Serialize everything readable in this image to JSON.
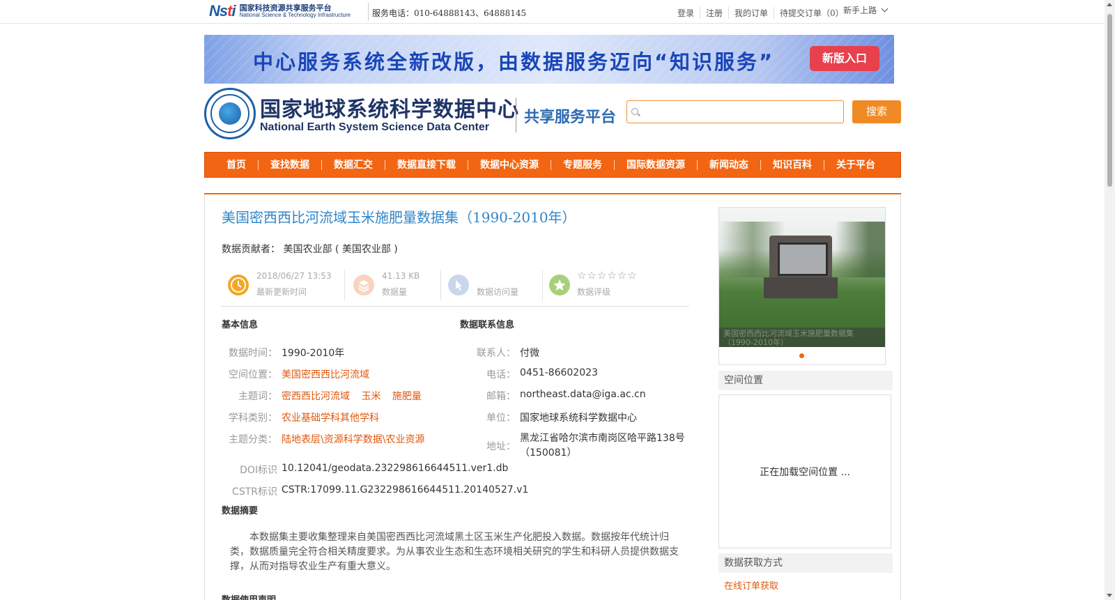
{
  "topbar": {
    "nsti_cn": "国家科技资源共享服务平台",
    "nsti_en": "National Science & Technology Infrastructure",
    "phone": "服务电话：010-64888143、64888145",
    "links": [
      "登录",
      "注册",
      "我的订单",
      "待提交订单（0）"
    ],
    "newbie": "新手上路"
  },
  "banner": {
    "text": "中心服务系统全新改版，由数据服务迈向“知识服务”",
    "button": "新版入口"
  },
  "header": {
    "center_cn": "国家地球系统科学数据中心",
    "center_en": "National Earth System Science Data Center",
    "platform": "共享服务平台",
    "search_placeholder": "",
    "search_button": "搜索"
  },
  "nav": [
    "首页",
    "查找数据",
    "数据汇交",
    "数据直接下载",
    "数据中心资源",
    "专题服务",
    "国际数据资源",
    "新闻动态",
    "知识百科",
    "关于平台"
  ],
  "dataset": {
    "title": "美国密西西比河流域玉米施肥量数据集（1990-2010年）",
    "contributor_label": "数据贡献者：",
    "contributor": "美国农业部 ( 美国农业部 )",
    "stats": {
      "updated_value": "2018/06/27 13:53",
      "updated_label": "最新更新时间",
      "size_value": "41.13 KB",
      "size_label": "数据量",
      "visits_label": "数据访问量",
      "stars": "☆☆☆☆☆☆",
      "rating_label": "数据评级"
    },
    "basic": {
      "heading": "基本信息",
      "time_label": "数据时间：",
      "time": "1990-2010年",
      "space_label": "空间位置：",
      "space": "美国密西西比河流域",
      "keywords_label": "主题词：",
      "keywords": [
        "密西西比河流域",
        "玉米",
        "施肥量"
      ],
      "discipline_label": "学科类别：",
      "discipline": "农业基础学科其他学科",
      "category_label": "主题分类：",
      "category": "陆地表层\\资源科学数据\\农业资源",
      "doi_label": "DOI标识",
      "doi": "10.12041/geodata.232298616644511.ver1.db",
      "cstr_label": "CSTR标识",
      "cstr": "CSTR:17099.11.G232298616644511.20140527.v1"
    },
    "contact": {
      "heading": "数据联系信息",
      "person_label": "联系人：",
      "person": "付微",
      "phone_label": "电话：",
      "phone": "0451-86602023",
      "email_label": "邮箱：",
      "email": "northeast.data@iga.ac.cn",
      "unit_label": "单位：",
      "unit": "国家地球系统科学数据中心",
      "address_label": "地址：",
      "address_1": "黑龙江省哈尔滨市南岗区哈平路138号",
      "address_2": "（150081）"
    },
    "abstract_heading": "数据摘要",
    "abstract": "本数据集主要收集整理来自美国密西西比河流域黑土区玉米生产化肥投入数据。数据按年代统计归类，数据质量完全符合相关精度要求。为从事农业生态和生态环境相关研究的学生和科研人员提供数据支撑，从而对指导农业生产有重大意义。",
    "usage_heading": "数据使用声明"
  },
  "sidebar": {
    "photo_caption": "美国密西西比河流域玉米施肥量数据集（1990-2010年）",
    "spatial_heading": "空间位置",
    "map_loading": "正在加载空间位置 ...",
    "access_heading": "数据获取方式",
    "order_link": "在线订单获取"
  },
  "colors": {
    "brand_orange": "#f26512",
    "title_blue": "#2f86c8",
    "link_orange": "#e2570b"
  }
}
